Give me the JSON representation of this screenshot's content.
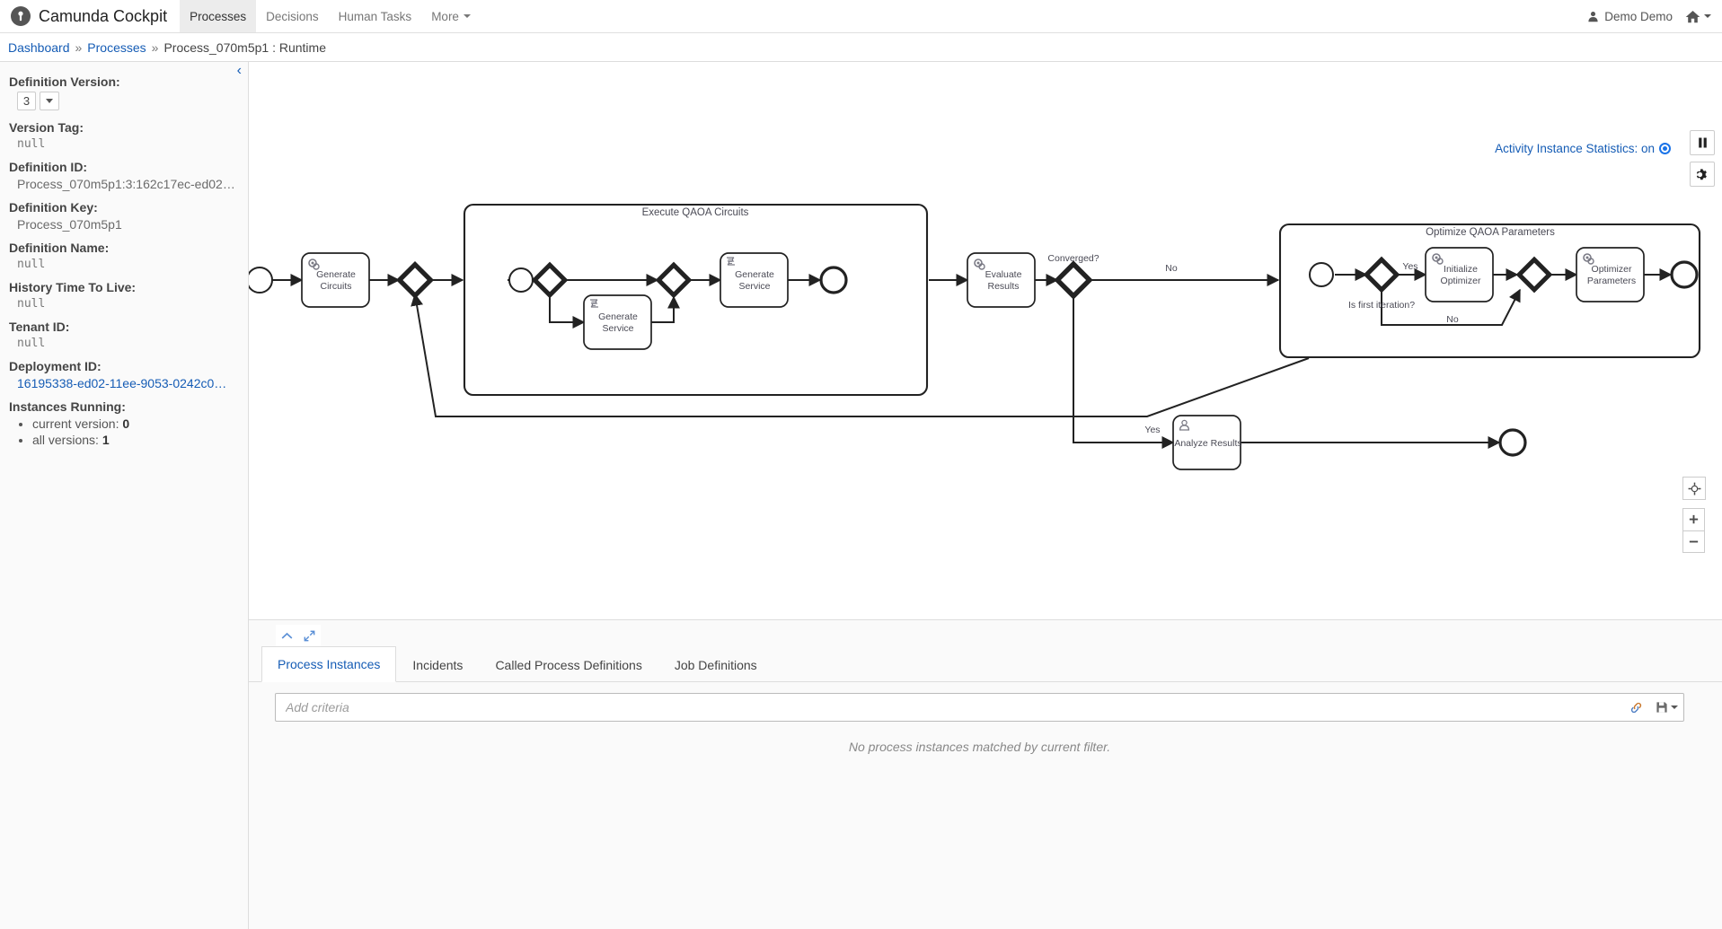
{
  "header": {
    "brand_title": "Camunda Cockpit",
    "logo_icon": "camunda-logo-icon",
    "nav": [
      {
        "label": "Processes",
        "active": true
      },
      {
        "label": "Decisions",
        "active": false
      },
      {
        "label": "Human Tasks",
        "active": false
      },
      {
        "label": "More",
        "active": false,
        "has_caret": true
      }
    ],
    "user_name": "Demo Demo",
    "user_icon": "user-icon",
    "home_icon": "home-icon"
  },
  "breadcrumb": {
    "items": [
      "Dashboard",
      "Processes",
      "Process_070m5p1 : Runtime"
    ],
    "separator": "»"
  },
  "sidebar": {
    "collapse_icon": "chevron-left-icon",
    "definition_version_label": "Definition Version:",
    "definition_version_value": "3",
    "version_tag_label": "Version Tag:",
    "version_tag_value": "null",
    "definition_id_label": "Definition ID:",
    "definition_id_value": "Process_070m5p1:3:162c17ec-ed02…",
    "definition_key_label": "Definition Key:",
    "definition_key_value": "Process_070m5p1",
    "definition_name_label": "Definition Name:",
    "definition_name_value": "null",
    "history_ttl_label": "History Time To Live:",
    "history_ttl_value": "null",
    "tenant_id_label": "Tenant ID:",
    "tenant_id_value": "null",
    "deployment_id_label": "Deployment ID:",
    "deployment_id_value": "16195338-ed02-11ee-9053-0242c0…",
    "instances_running_label": "Instances Running:",
    "instances": [
      {
        "text": "current version: ",
        "value": "0"
      },
      {
        "text": "all versions: ",
        "value": "1"
      }
    ]
  },
  "canvas": {
    "activity_stats_label": "Activity Instance Statistics: on",
    "pause_icon": "pause-icon",
    "gear_icon": "gear-icon",
    "reset_zoom_icon": "crosshair-icon",
    "zoom_in_icon": "plus-icon",
    "zoom_out_icon": "minus-icon"
  },
  "diagram": {
    "type": "bpmn",
    "subprocesses": [
      {
        "id": "sp-execute",
        "label": "Execute QAOA Circuits"
      },
      {
        "id": "sp-optimize",
        "label": "Optimize QAOA Parameters"
      }
    ],
    "tasks": [
      {
        "id": "t-generate-circuits",
        "label_line1": "Generate",
        "label_line2": "Circuits",
        "icon": "service-task-icon"
      },
      {
        "id": "t-generate-service-1",
        "label_line1": "Generate",
        "label_line2": "Service",
        "icon": "script-task-icon"
      },
      {
        "id": "t-generate-service-2",
        "label_line1": "Generate",
        "label_line2": "Service",
        "icon": "script-task-icon"
      },
      {
        "id": "t-evaluate-results",
        "label_line1": "Evaluate",
        "label_line2": "Results",
        "icon": "service-task-icon"
      },
      {
        "id": "t-initialize-optimizer",
        "label_line1": "Initialize",
        "label_line2": "Optimizer",
        "icon": "service-task-icon"
      },
      {
        "id": "t-optimizer-parameters",
        "label_line1": "Optimizer",
        "label_line2": "Parameters",
        "icon": "service-task-icon"
      },
      {
        "id": "t-analyze-results",
        "label_line1": "Analyze Results",
        "label_line2": "",
        "icon": "user-task-icon"
      }
    ],
    "gateway_labels": [
      {
        "id": "g-converged",
        "label": "Converged?"
      },
      {
        "id": "g-first-iteration",
        "label": "Is first iteration?"
      }
    ],
    "flow_labels": [
      {
        "id": "f-no-converged",
        "label": "No"
      },
      {
        "id": "f-yes-converged",
        "label": "Yes"
      },
      {
        "id": "f-yes-first",
        "label": "Yes"
      },
      {
        "id": "f-no-first",
        "label": "No"
      }
    ]
  },
  "bottom": {
    "collapse_icon": "chevron-up-icon",
    "expand_icon": "expand-icon",
    "tabs": [
      {
        "label": "Process Instances",
        "active": true
      },
      {
        "label": "Incidents",
        "active": false
      },
      {
        "label": "Called Process Definitions",
        "active": false
      },
      {
        "label": "Job Definitions",
        "active": false
      }
    ],
    "filter_placeholder": "Add criteria",
    "filter_value": "",
    "link_icon": "link-icon",
    "save_icon": "floppy-disk-icon",
    "empty_message": "No process instances matched by current filter."
  },
  "colors": {
    "link": "#155cb5",
    "accent": "#1a73e8",
    "bpmn_stroke": "#222222",
    "bpmn_label": "#4a4a55"
  }
}
